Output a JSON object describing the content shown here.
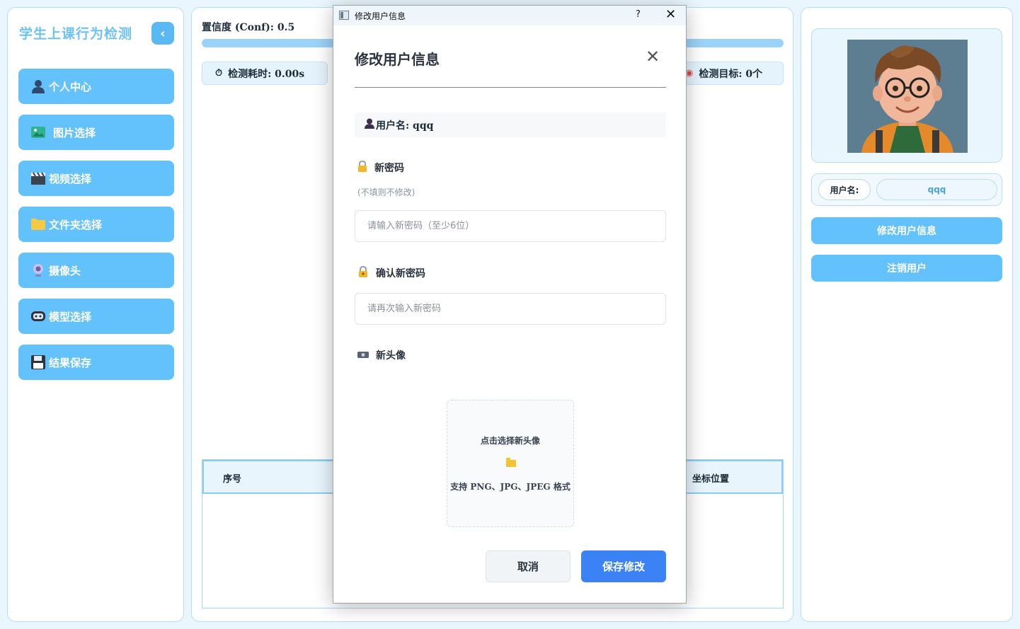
{
  "sidebar": {
    "title": "学生上课行为检测",
    "collapse_icon": "chevron-left-icon",
    "items": [
      {
        "icon": "person-icon",
        "label": "个人中心"
      },
      {
        "icon": "image-icon",
        "label": "图片选择"
      },
      {
        "icon": "clapperboard-icon",
        "label": "视频选择"
      },
      {
        "icon": "folder-icon",
        "label": "文件夹选择"
      },
      {
        "icon": "webcam-icon",
        "label": "摄像头"
      },
      {
        "icon": "robot-icon",
        "label": "模型选择"
      },
      {
        "icon": "floppy-disk-icon",
        "label": "结果保存"
      }
    ]
  },
  "main": {
    "confidence_label": "置信度 (Conf): 0.5",
    "detect_time": "检测耗时: 0.00s",
    "detect_targets": "检测目标: 0个",
    "table": {
      "columns": [
        "序号",
        "坐标位置"
      ]
    }
  },
  "profile": {
    "username_label": "用户名:",
    "username_value": "qqq",
    "edit_button": "修改用户信息",
    "logout_button": "注销用户"
  },
  "dialog": {
    "window_title": "修改用户信息",
    "help_glyph": "?",
    "close_glyph": "✕",
    "heading": "修改用户信息",
    "username_line": "用户名: qqq",
    "new_password_label": "新密码",
    "new_password_hint": "(不填则不修改)",
    "new_password_placeholder": "请输入新密码（至少6位）",
    "confirm_password_label": "确认新密码",
    "confirm_password_placeholder": "请再次输入新密码",
    "new_avatar_label": "新头像",
    "upload_text": "点击选择新头像",
    "upload_formats": "支持 PNG、JPG、JPEG 格式",
    "cancel_button": "取消",
    "save_button": "保存修改"
  },
  "colors": {
    "accent": "#63c1fb",
    "primary_button": "#3b82f6",
    "title_text": "#6fc2f5"
  }
}
